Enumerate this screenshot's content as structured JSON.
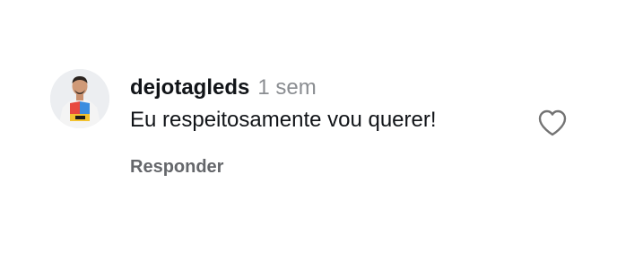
{
  "comment": {
    "username": "dejotagleds",
    "time": "1 sem",
    "text": "Eu respeitosamente vou querer!",
    "reply_label": "Responder",
    "avatar_icon": "user-avatar",
    "like_icon": "heart-outline-icon"
  },
  "colors": {
    "primary_text": "#111418",
    "secondary_text": "#8a8d91",
    "reply_text": "#65676b",
    "icon_stroke": "#737373"
  }
}
